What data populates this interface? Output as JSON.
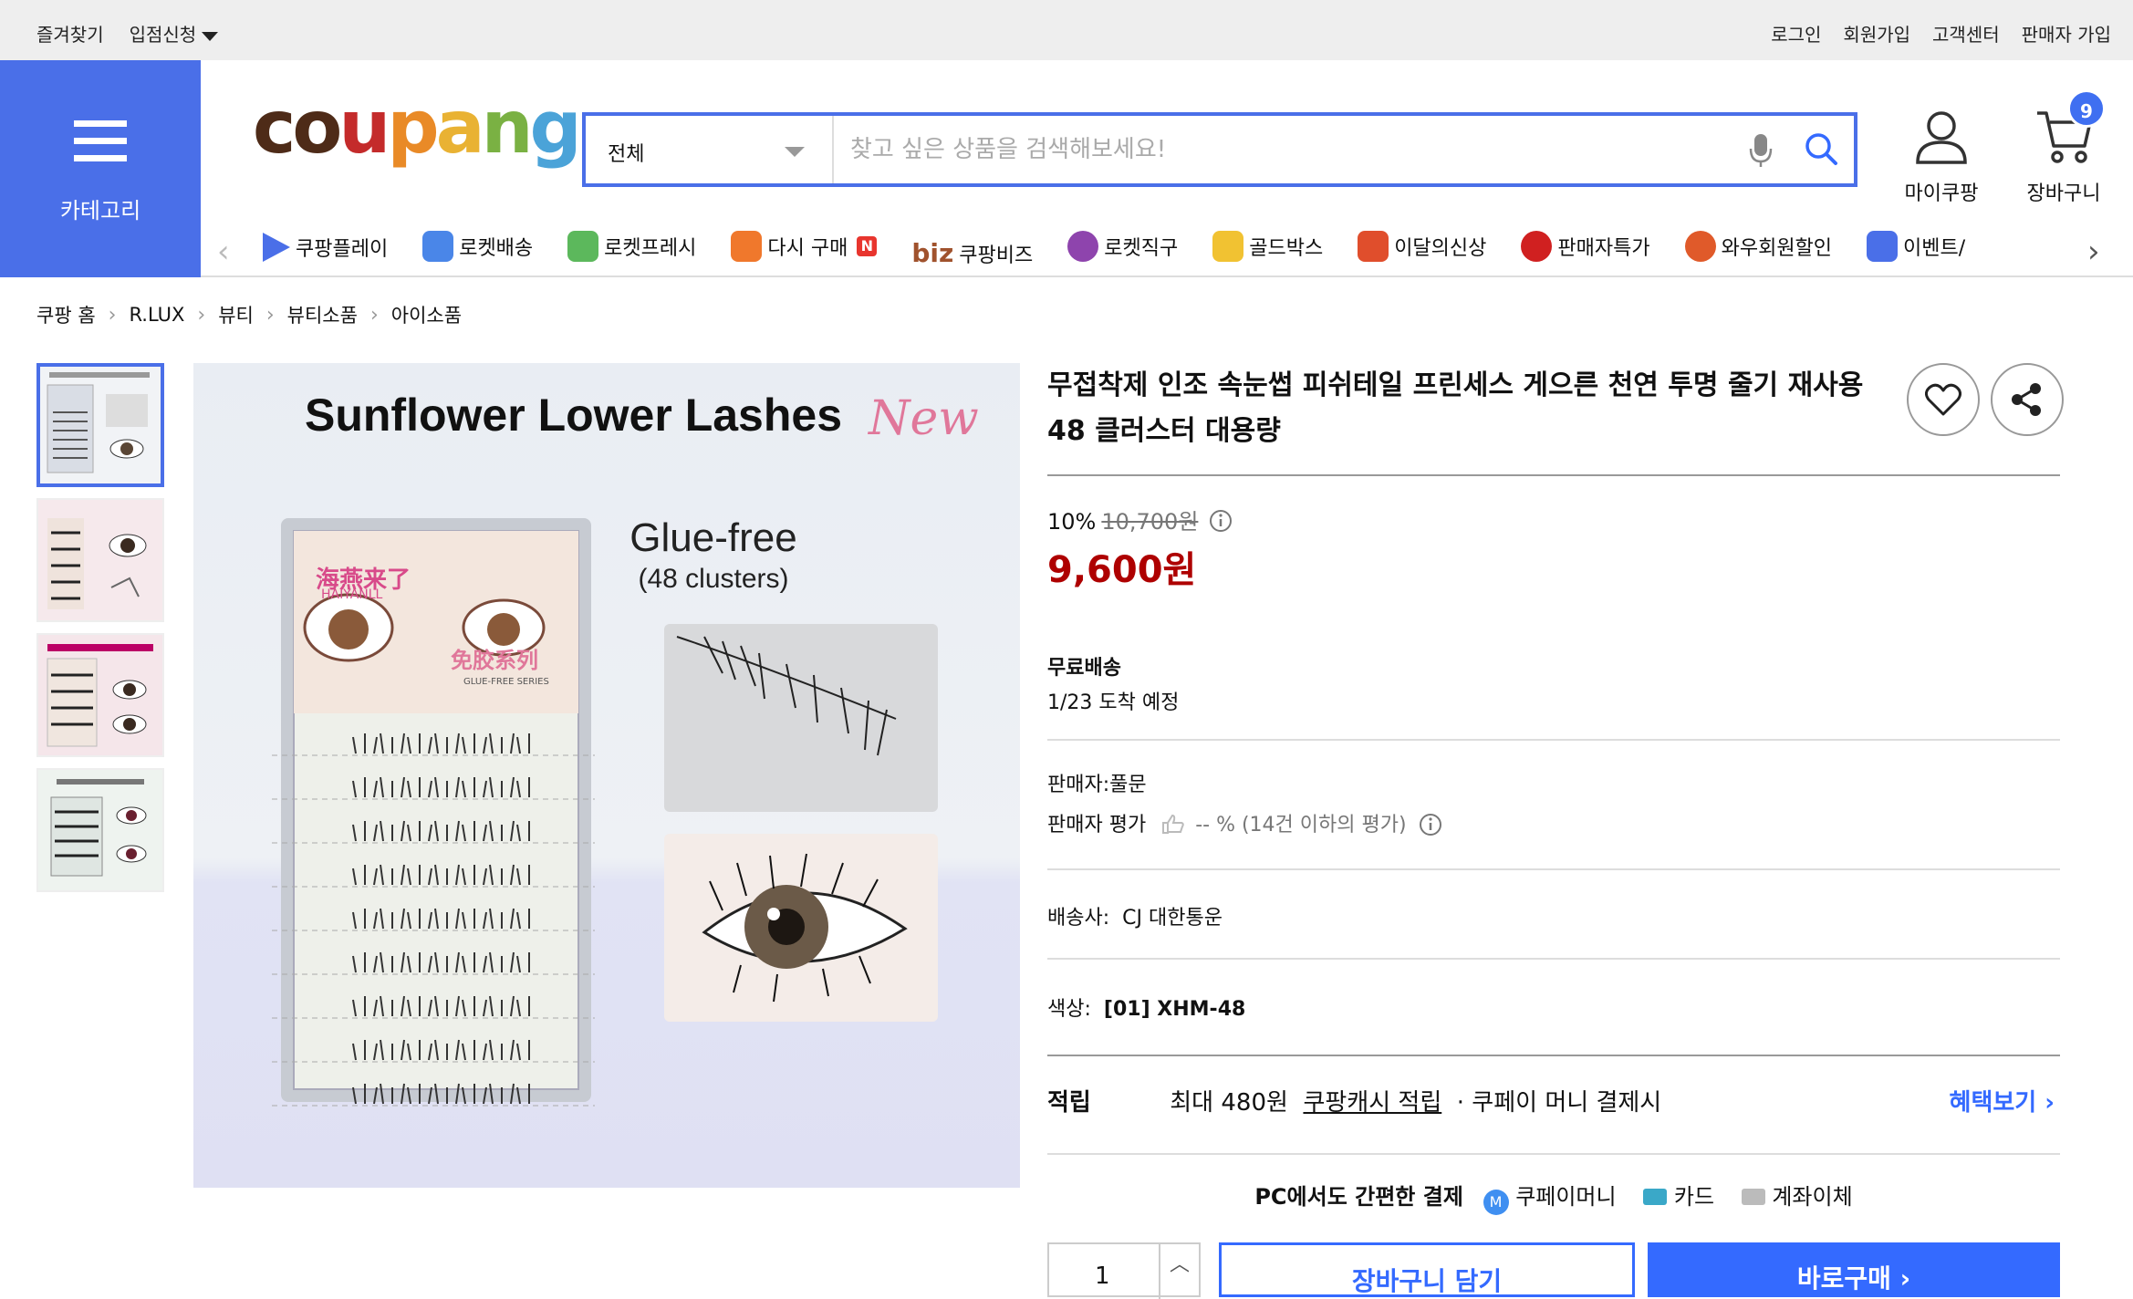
{
  "topbar": {
    "left": [
      "즐겨찾기",
      "입점신청"
    ],
    "right": [
      "로그인",
      "회원가입",
      "고객센터",
      "판매자 가입"
    ]
  },
  "category_button": {
    "label": "카테고리"
  },
  "logo": {
    "text": "coupang",
    "letters": [
      {
        "ch": "c",
        "color": "#4e2b18"
      },
      {
        "ch": "o",
        "color": "#4e2b18"
      },
      {
        "ch": "u",
        "color": "#c42b2b"
      },
      {
        "ch": "p",
        "color": "#e98a27"
      },
      {
        "ch": "a",
        "color": "#e9b233"
      },
      {
        "ch": "n",
        "color": "#7ab143"
      },
      {
        "ch": "g",
        "color": "#4ba3d8"
      }
    ]
  },
  "search": {
    "category": "전체",
    "placeholder": "찾고 싶은 상품을 검색해보세요!"
  },
  "header": {
    "mycoupang": "마이쿠팡",
    "cart": "장바구니",
    "cart_count": "9"
  },
  "nav": {
    "items": [
      {
        "label": "쿠팡플레이",
        "icon": "play-icon",
        "color": "#4a6fe8"
      },
      {
        "label": "로켓배송",
        "icon": "rocket-icon",
        "color": "#4a86e8"
      },
      {
        "label": "로켓프레시",
        "icon": "rocket-fresh-icon",
        "color": "#5cb85c"
      },
      {
        "label": "다시 구매",
        "icon": "basket-icon",
        "color": "#f0782c",
        "badge": "N"
      },
      {
        "label": "쿠팡비즈",
        "icon": "biz-icon",
        "color": "#a0522d",
        "prefix": "biz"
      },
      {
        "label": "로켓직구",
        "icon": "rocket-global-icon",
        "color": "#8e44ad"
      },
      {
        "label": "골드박스",
        "icon": "goldbox-icon",
        "color": "#f1c232"
      },
      {
        "label": "이달의신상",
        "icon": "new-bag-icon",
        "color": "#e04e2c"
      },
      {
        "label": "판매자특가",
        "icon": "percent-badge-icon",
        "color": "#d02020"
      },
      {
        "label": "와우회원할인",
        "icon": "wow-icon",
        "color": "#e05a2a"
      },
      {
        "label": "이벤트/",
        "icon": "event-ticket-icon",
        "color": "#4a6fe8"
      }
    ]
  },
  "breadcrumb": [
    "쿠팡 홈",
    "R.LUX",
    "뷰티",
    "뷰티소품",
    "아이소품"
  ],
  "product": {
    "title": "무접착제 인조 속눈썹 피쉬테일 프린세스 게으른 천연 투명 줄기 재사용 48 클러스터 대용량",
    "image": {
      "title": "Sunflower Lower Lashes",
      "title_new": "New",
      "glue": "Glue-free",
      "clusters": "(48 clusters)",
      "pack_brand": "海燕来了",
      "pack_sub": "HAIYANLL",
      "pack_series": "免胶系列",
      "pack_series_en": "GLUE-FREE SERIES"
    },
    "thumbnails": [
      "thumb-1",
      "thumb-2",
      "thumb-3",
      "thumb-4"
    ]
  },
  "price": {
    "discount": "10%",
    "original": "10,700원",
    "sale": "9,600원"
  },
  "shipping": {
    "label": "무료배송",
    "arrival": "1/23 도착 예정"
  },
  "seller": {
    "name": "판매자:풀문",
    "rating_label": "판매자 평가",
    "rating_value": "-- % (14건 이하의 평가)"
  },
  "carrier": {
    "label": "배송사:",
    "value": "CJ 대한통운"
  },
  "color": {
    "label": "색상:",
    "value": "[01] XHM-48"
  },
  "reward": {
    "label": "적립",
    "max": "최대 480원",
    "cash": "쿠팡캐시 적립",
    "pay": "· 쿠페이 머니 결제시",
    "more": "혜택보기"
  },
  "pcpay": {
    "title": "PC에서도 간편한 결제",
    "methods": [
      "쿠페이머니",
      "카드",
      "계좌이체"
    ]
  },
  "buy": {
    "qty": "1",
    "addcart": "장바구니 담기",
    "buynow": "바로구매"
  }
}
